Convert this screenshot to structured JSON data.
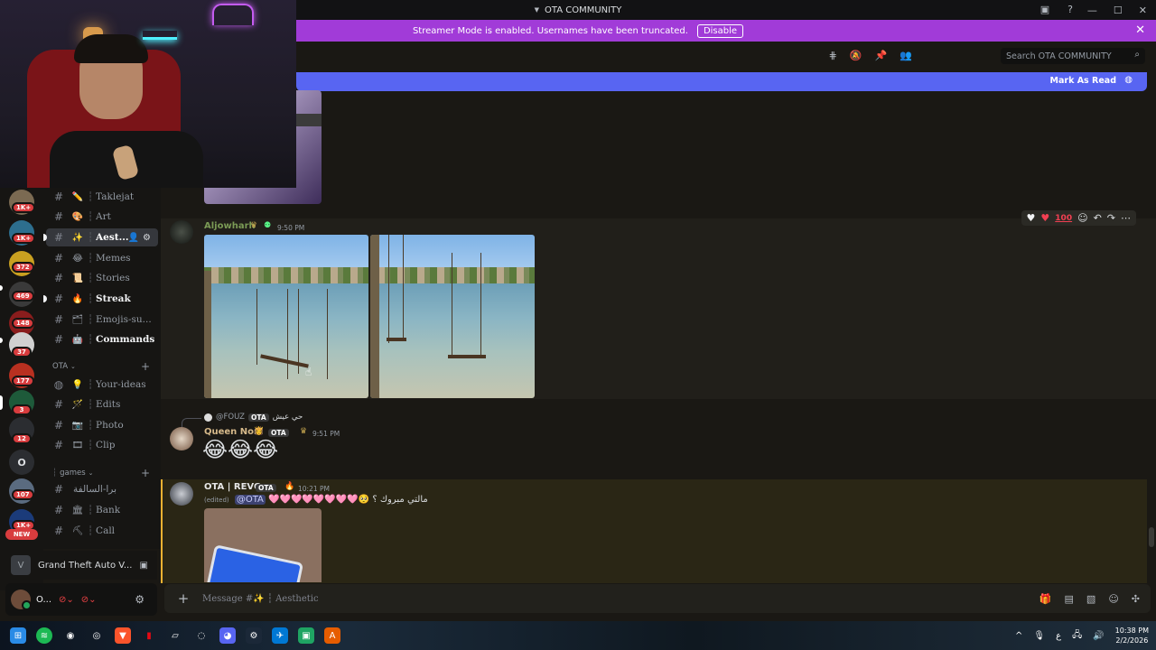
{
  "window": {
    "title": "OTA COMMUNITY"
  },
  "streamer_banner": {
    "text": "Streamer Mode is enabled. Usernames have been truncated.",
    "disable_label": "Disable"
  },
  "header": {
    "search_placeholder": "Search OTA COMMUNITY"
  },
  "new_messages_bar": {
    "mark_read_label": "Mark As Read"
  },
  "server_rail": {
    "badges": [
      "1K+",
      "1K+",
      "372",
      "469",
      "148",
      "37",
      "177",
      "3",
      "12",
      "107",
      "1K+"
    ],
    "letter_server": "O",
    "new_label": "NEW"
  },
  "sidebar": {
    "channels": [
      {
        "emoji": "✏️",
        "label": "Taklejat",
        "bold": false
      },
      {
        "emoji": "🎨",
        "label": "Art",
        "bold": false
      },
      {
        "emoji": "✨",
        "label": "Aest...",
        "bold": true,
        "active": true
      },
      {
        "emoji": "😂",
        "label": "Memes",
        "bold": false
      },
      {
        "emoji": "📜",
        "label": "Stories",
        "bold": false
      },
      {
        "emoji": "🔥",
        "label": "Streak",
        "bold": true
      },
      {
        "emoji": "🗂",
        "label": "Emojis-su...",
        "bold": false
      },
      {
        "emoji": "🤖",
        "label": "Commands",
        "bold": true
      }
    ],
    "category_ota": "OTA",
    "ota_channels": [
      {
        "emoji": "💡",
        "label": "Your-ideas"
      },
      {
        "emoji": "🪄",
        "label": "Edits"
      },
      {
        "emoji": "📷",
        "label": "Photo"
      },
      {
        "emoji": "🎞",
        "label": "Clip"
      }
    ],
    "category_games": "games",
    "games_channels": [
      {
        "emoji": "",
        "label": "برا-السالفة"
      },
      {
        "emoji": "🏛",
        "label": "Bank"
      },
      {
        "emoji": "⛏",
        "label": "Call"
      }
    ]
  },
  "game_activity": {
    "name": "Grand Theft Auto V..."
  },
  "user_panel": {
    "name": "O..."
  },
  "messages": {
    "m1": {
      "author": "Aljowharh",
      "time": "9:50 PM"
    },
    "m2": {
      "reply_user": "@FOUZ",
      "reply_tag": "OTA",
      "reply_text": "حي عيش",
      "author": "Queen Noni",
      "tag": "OTA",
      "time": "9:51 PM",
      "emojis": "😂😂😂"
    },
    "m3": {
      "author": "OTA | REVO",
      "tag": "OTA",
      "time": "10:21 PM",
      "edited": "(edited)",
      "mention": "@OTA",
      "body": "🩷🩷🩷🩷🩷🩷🩷🩷🥺 مالتي مبروك ؟"
    }
  },
  "reactions": [
    "white-heart",
    "red-heart",
    "hundred",
    "add-reaction",
    "reply",
    "forward",
    "more"
  ],
  "composer": {
    "placeholder": "Message #✨ ┆ Aesthetic"
  },
  "taskbar": {
    "time": "10:38 PM",
    "date": "2/2/2026",
    "lang": "ع"
  },
  "colors": {
    "accent": "#5865f2",
    "streamer": "#a13bd8",
    "highlight": "#f0b232"
  }
}
